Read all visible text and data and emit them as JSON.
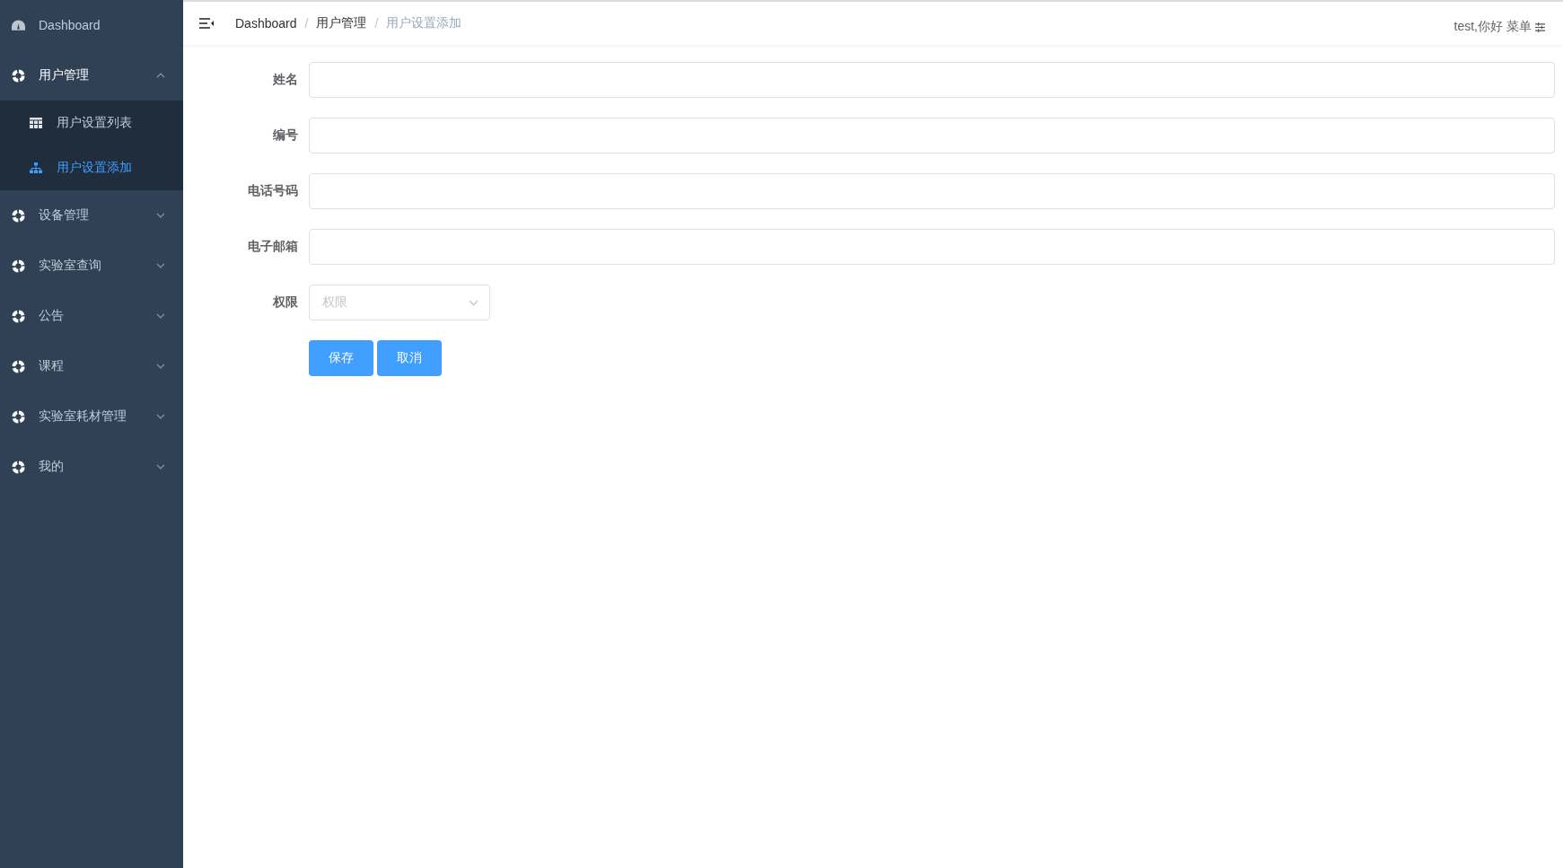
{
  "sidebar": {
    "items": [
      {
        "label": "Dashboard",
        "kind": "link"
      },
      {
        "label": "用户管理",
        "kind": "submenu",
        "expanded": true,
        "children": [
          {
            "label": "用户设置列表",
            "selected": false
          },
          {
            "label": "用户设置添加",
            "selected": true
          }
        ]
      },
      {
        "label": "设备管理",
        "kind": "submenu",
        "expanded": false
      },
      {
        "label": "实验室查询",
        "kind": "submenu",
        "expanded": false
      },
      {
        "label": "公告",
        "kind": "submenu",
        "expanded": false
      },
      {
        "label": "课程",
        "kind": "submenu",
        "expanded": false
      },
      {
        "label": "实验室耗材管理",
        "kind": "submenu",
        "expanded": false
      },
      {
        "label": "我的",
        "kind": "submenu",
        "expanded": false
      }
    ]
  },
  "breadcrumb": {
    "separator": "/",
    "items": [
      "Dashboard",
      "用户管理",
      "用户设置添加"
    ]
  },
  "user_menu": {
    "greeting": "test,你好",
    "menu": "菜单"
  },
  "form": {
    "fields": [
      {
        "label": "姓名",
        "kind": "text"
      },
      {
        "label": "编号",
        "kind": "text"
      },
      {
        "label": "电话号码",
        "kind": "text"
      },
      {
        "label": "电子邮箱",
        "kind": "text"
      },
      {
        "label": "权限",
        "kind": "select",
        "placeholder": "权限"
      }
    ],
    "buttons": [
      "保存",
      "取消"
    ]
  }
}
